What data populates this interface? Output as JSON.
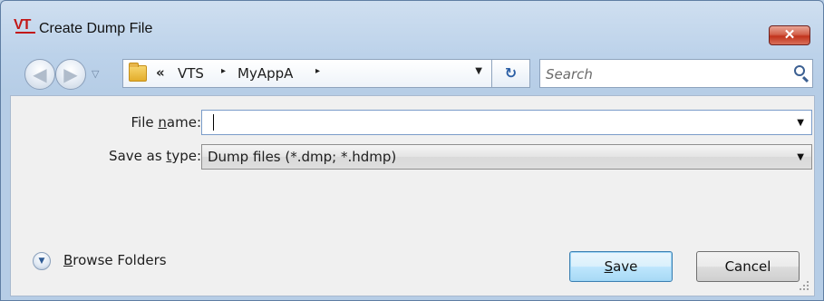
{
  "window": {
    "icon_text": "VT",
    "title": "Create Dump File",
    "close_symbol": "✕"
  },
  "navigation": {
    "back_symbol": "◀",
    "forward_symbol": "▶",
    "history_dropdown_symbol": "▽",
    "breadcrumb": {
      "overflow": "«",
      "items": [
        "VTS",
        "MyAppA"
      ],
      "separator": "▸",
      "dropdown_symbol": "▼"
    },
    "refresh_symbol": "↻",
    "search": {
      "placeholder": "Search"
    }
  },
  "form": {
    "file_name": {
      "label_pre": "File ",
      "label_accel": "n",
      "label_post": "ame:",
      "value": "",
      "dropdown_symbol": "▼"
    },
    "save_as_type": {
      "label_pre": "Save as ",
      "label_accel": "t",
      "label_post": "ype:",
      "value": "Dump files (*.dmp; *.hdmp)",
      "dropdown_symbol": "▼"
    }
  },
  "footer": {
    "browse_folders": {
      "accel": "B",
      "rest": "rowse Folders",
      "icon_symbol": "▼"
    },
    "save_button": {
      "accel": "S",
      "rest": "ave"
    },
    "cancel_button": {
      "label": "Cancel"
    }
  },
  "colors": {
    "title_accent": "#c21818",
    "close_button": "#c2331c",
    "default_button_border": "#3c7fb1"
  },
  "icons": [
    "app-logo-icon",
    "close-icon",
    "back-arrow-icon",
    "forward-arrow-icon",
    "folder-icon",
    "refresh-icon",
    "search-icon",
    "chevron-down-icon",
    "expand-icon",
    "resize-grip-icon"
  ]
}
